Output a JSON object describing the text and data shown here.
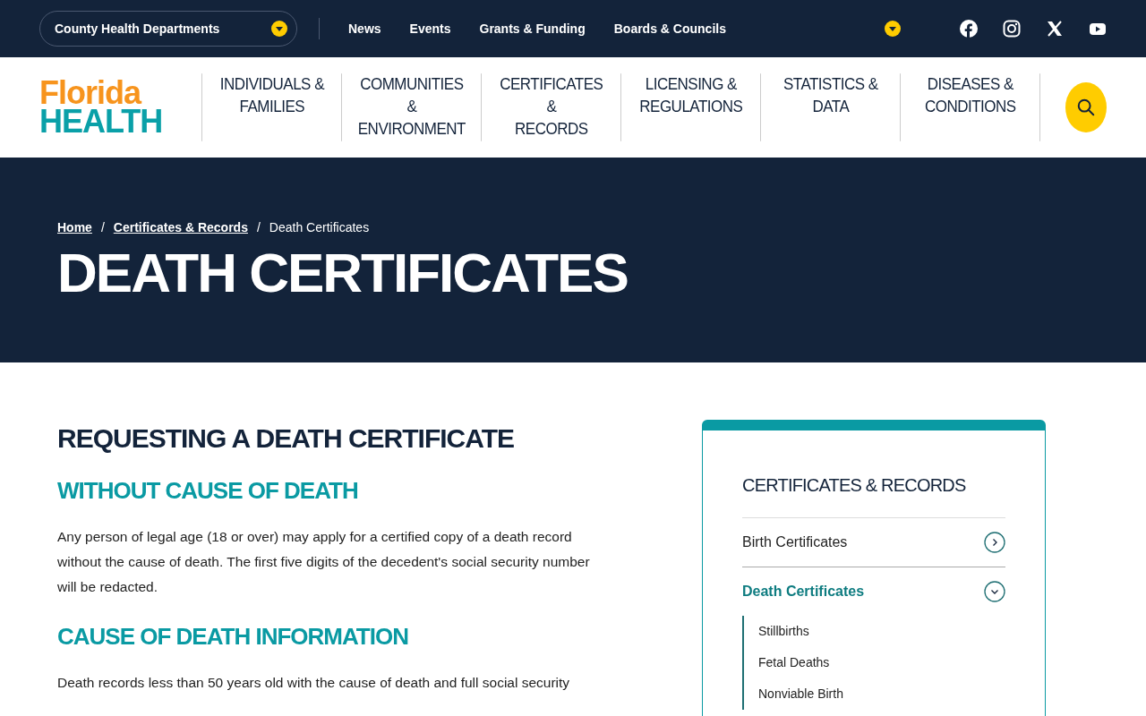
{
  "top_bar": {
    "county_select": {
      "label": "County Health Departments"
    },
    "links": [
      "News",
      "Events",
      "Grants & Funding",
      "Boards & Councils"
    ]
  },
  "header": {
    "logo": {
      "line_1": "Florida",
      "line_2": "HEALTH"
    },
    "nav": [
      {
        "label": "INDIVIDUALS &\nFAMILIES"
      },
      {
        "label": "COMMUNITIES\n&\nENVIRONMENT"
      },
      {
        "label": "CERTIFICATES\n&\nRECORDS"
      },
      {
        "label": "LICENSING &\nREGULATIONS"
      },
      {
        "label": "STATISTICS &\nDATA"
      },
      {
        "label": "DISEASES &\nCONDITIONS"
      }
    ]
  },
  "hero": {
    "breadcrumbs": [
      {
        "label": "Home",
        "link": true
      },
      {
        "label": "Certificates & Records",
        "link": true
      },
      {
        "label": "Death Certificates",
        "link": false
      }
    ],
    "separator": "/",
    "title": "DEATH CERTIFICATES"
  },
  "content": {
    "heading": "REQUESTING A DEATH CERTIFICATE",
    "sections": [
      {
        "heading": "WITHOUT CAUSE OF DEATH",
        "text": "Any person of legal age (18 or over) may apply for a certified copy of a death record without the cause of death. The first five digits of the decedent's social security number will be redacted."
      },
      {
        "heading": "CAUSE OF DEATH INFORMATION",
        "text": "Death records less than 50 years old with the cause of death and full social security"
      }
    ]
  },
  "sidebar": {
    "title": "CERTIFICATES & RECORDS",
    "items": [
      {
        "label": "Birth Certificates",
        "selected": false,
        "expanded": false
      },
      {
        "label": "Death Certificates",
        "selected": true,
        "expanded": true,
        "children": [
          {
            "label": "Stillbirths"
          },
          {
            "label": "Fetal Deaths"
          },
          {
            "label": "Nonviable Birth"
          }
        ]
      }
    ]
  }
}
